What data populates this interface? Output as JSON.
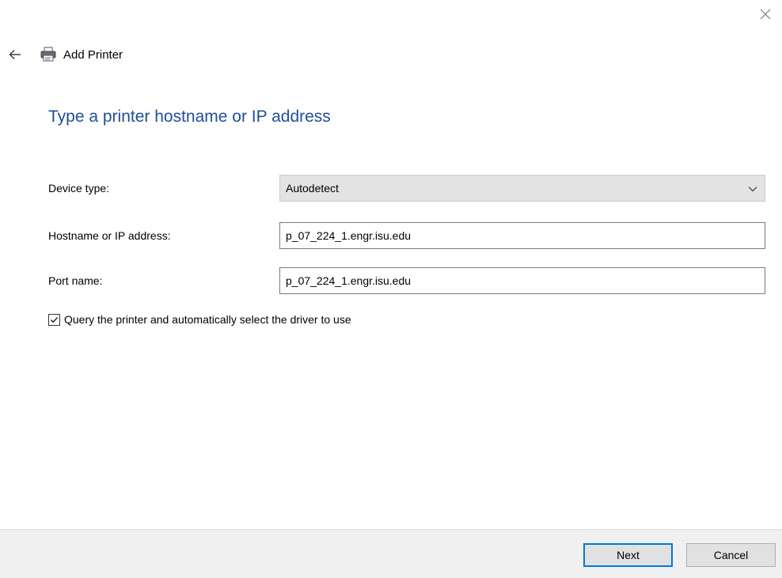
{
  "window": {
    "title": "Add Printer",
    "close_icon": "close-icon",
    "back_icon": "back-arrow-icon",
    "printer_icon": "printer-icon"
  },
  "page": {
    "heading": "Type a printer hostname or IP address",
    "heading_color": "#1f4e9c"
  },
  "form": {
    "device_type": {
      "label": "Device type:",
      "selected": "Autodetect"
    },
    "hostname": {
      "label": "Hostname or IP address:",
      "value": "p_07_224_1.engr.isu.edu"
    },
    "port": {
      "label": "Port name:",
      "value": "p_07_224_1.engr.isu.edu"
    },
    "query_driver": {
      "label": "Query the printer and automatically select the driver to use",
      "checked": true
    }
  },
  "footer": {
    "next_label": "Next",
    "cancel_label": "Cancel",
    "accent_color": "#0078d7"
  }
}
